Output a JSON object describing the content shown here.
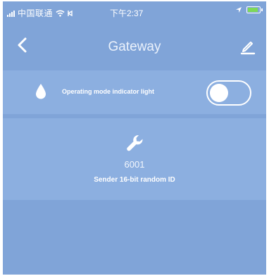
{
  "status_bar": {
    "carrier": "中国联通",
    "time": "下午2:37",
    "icons": [
      "signal-icon",
      "wifi-icon",
      "location-arrow-icon",
      "battery-icon"
    ],
    "battery_color": "#7ed957"
  },
  "nav": {
    "title": "Gateway",
    "back_icon": "chevron-left-icon",
    "edit_icon": "pencil-icon"
  },
  "indicator": {
    "icon": "drop-icon",
    "label": "Operating mode indicator light",
    "toggle_on": false
  },
  "sender": {
    "icon": "wrench-icon",
    "id_value": "6001",
    "caption": "Sender 16-bit random ID"
  },
  "colors": {
    "background": "#80a4d8",
    "card": "#8cafe0",
    "text": "#ffffff"
  }
}
